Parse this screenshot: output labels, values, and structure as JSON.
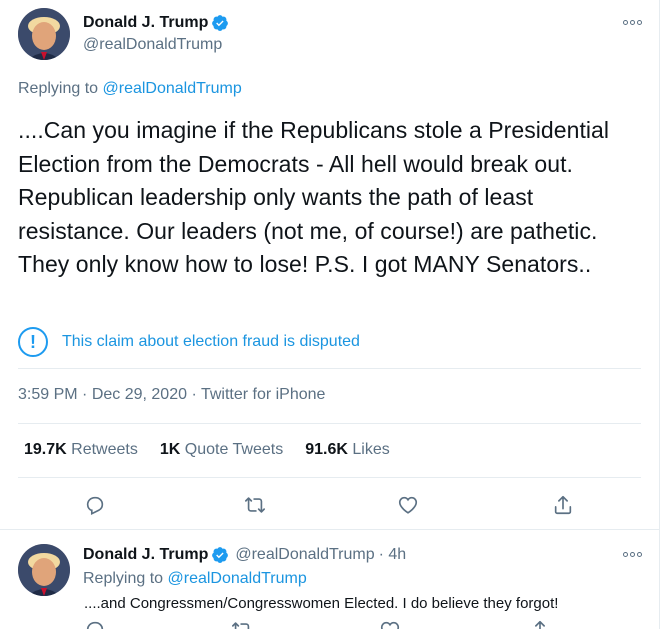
{
  "main_tweet": {
    "author_name": "Donald J. Trump",
    "author_handle": "@realDonaldTrump",
    "replying_prefix": "Replying to ",
    "replying_to": "@realDonaldTrump",
    "text": "....Can you imagine if the Republicans stole a Presidential Election from the Democrats - All hell would break out. Republican leadership only wants the path of least resistance. Our leaders (not me, of course!) are pathetic. They only know how to lose! P.S. I got MANY Senators..",
    "label": "This claim about election fraud is disputed",
    "time": "3:59 PM",
    "date": "Dec 29, 2020",
    "source": "Twitter for iPhone",
    "separator": " · ",
    "stats": {
      "retweets_count": "19.7K",
      "retweets_label": "Retweets",
      "quotes_count": "1K",
      "quotes_label": "Quote Tweets",
      "likes_count": "91.6K",
      "likes_label": "Likes"
    }
  },
  "reply_tweet": {
    "author_name": "Donald J. Trump",
    "author_handle": "@realDonaldTrump",
    "age": "· 4h",
    "replying_prefix": "Replying to ",
    "replying_to": "@realDonaldTrump",
    "text": "....and Congressmen/Congresswomen Elected. I do believe they forgot!"
  },
  "colors": {
    "accent": "#1b95e0",
    "text": "#0f1419",
    "secondary": "#5b7083",
    "divider": "#e6ecf0"
  },
  "icons": [
    "verified-badge-icon",
    "more-options-icon",
    "info-icon",
    "reply-icon",
    "retweet-icon",
    "like-icon",
    "share-icon"
  ]
}
